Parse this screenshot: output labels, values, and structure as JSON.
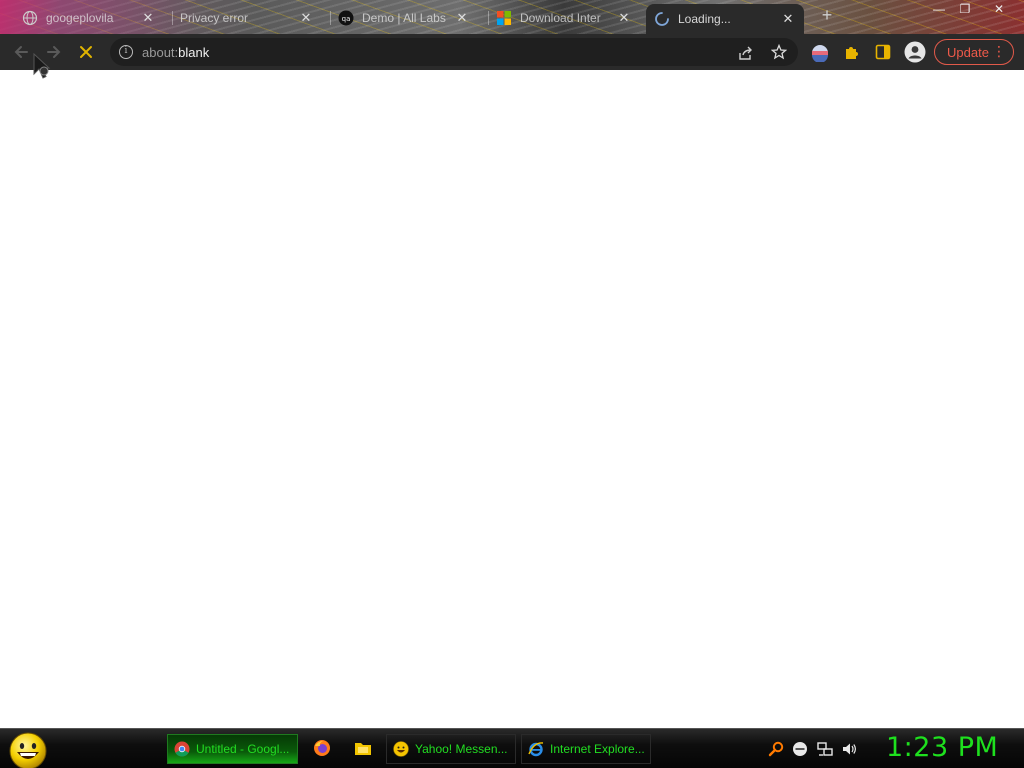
{
  "browser": {
    "tabs": [
      {
        "title": "googeplovila",
        "favicon": "globe-icon",
        "close": "✕"
      },
      {
        "title": "Privacy error",
        "favicon": "none",
        "close": "✕"
      },
      {
        "title": "Demo | All Labs",
        "favicon": "qa-logo-icon",
        "close": "✕"
      },
      {
        "title": "Download Inter",
        "favicon": "microsoft-logo-icon",
        "close": "✕"
      },
      {
        "title": "Loading...",
        "favicon": "spinner-icon",
        "close": "✕",
        "active": true
      }
    ],
    "new_tab": "+",
    "window_controls": {
      "minimize": "—",
      "maximize": "❐",
      "close": "✕"
    },
    "address": {
      "scheme": "about:",
      "host": "blank"
    },
    "update_label": "Update",
    "menu_label": "⋮"
  },
  "taskbar": {
    "items": [
      {
        "label": "Untitled - Googl...",
        "icon": "chrome-icon",
        "active": true
      },
      {
        "label": "Yahoo! Messen...",
        "icon": "yahoo-messenger-icon",
        "active": false
      },
      {
        "label": "Internet Explore...",
        "icon": "internet-explorer-icon",
        "active": false
      }
    ],
    "clock": "1:23 PM"
  },
  "colors": {
    "chrome_dark": "#2a2a2a",
    "omnibox": "#1f1f1f",
    "update_red": "#ee5a4a",
    "taskbar_green": "#1ee01e"
  }
}
